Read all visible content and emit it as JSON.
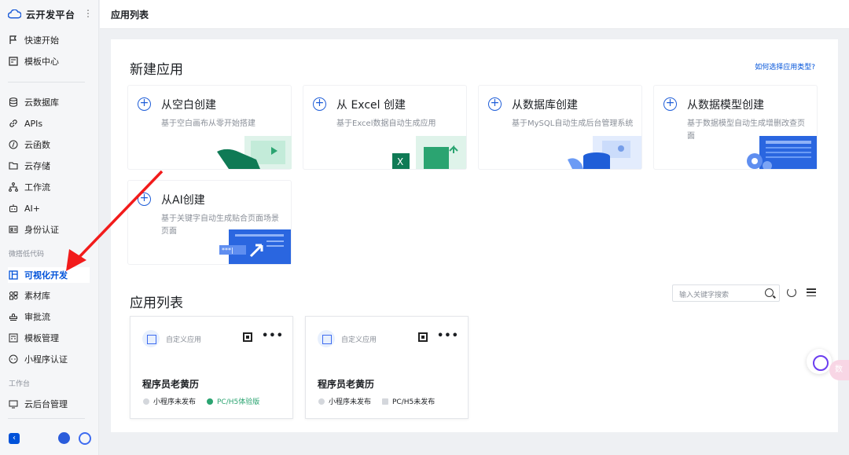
{
  "app": {
    "title": "云开发平台"
  },
  "header": {
    "title": "应用列表"
  },
  "sidebar": {
    "items": [
      {
        "label": "快速开始"
      },
      {
        "label": "模板中心"
      },
      {
        "label": "云数据库"
      },
      {
        "label": "APIs"
      },
      {
        "label": "云函数"
      },
      {
        "label": "云存储"
      },
      {
        "label": "工作流"
      },
      {
        "label": "AI+"
      },
      {
        "label": "身份认证"
      },
      {
        "label": "可视化开发"
      },
      {
        "label": "素材库"
      },
      {
        "label": "审批流"
      },
      {
        "label": "模板管理"
      },
      {
        "label": "小程序认证"
      },
      {
        "label": "云后台管理"
      }
    ],
    "groups": {
      "lowcode": "微搭低代码",
      "workbench": "工作台"
    },
    "active": "可视化开发"
  },
  "new_app": {
    "heading": "新建应用",
    "help_link": "如何选择应用类型?",
    "cards": [
      {
        "title": "从空白创建",
        "desc": "基于空白画布从零开始搭建"
      },
      {
        "title": "从 Excel 创建",
        "desc": "基于Excel数据自动生成应用"
      },
      {
        "title": "从数据库创建",
        "desc": "基于MySQL自动生成后台管理系统"
      },
      {
        "title": "从数据模型创建",
        "desc": "基于数据模型自动生成增删改查页面"
      },
      {
        "title": "从AI创建",
        "desc": "基于关键字自动生成贴合页面场景页面"
      }
    ]
  },
  "app_list": {
    "heading": "应用列表",
    "search_placeholder": "输入关键字搜索",
    "apps": [
      {
        "type": "自定义应用",
        "name": "程序员老黄历",
        "miniprogram_status": "小程序未发布",
        "web_status": "PC/H5体验版"
      },
      {
        "type": "自定义应用",
        "name": "程序员老黄历",
        "miniprogram_status": "小程序未发布",
        "web_status": "PC/H5未发布"
      }
    ]
  },
  "float_badge": "数",
  "colors": {
    "accent": "#0052d9",
    "arrow": "#f21b1b",
    "experience_green": "#2ba471"
  }
}
